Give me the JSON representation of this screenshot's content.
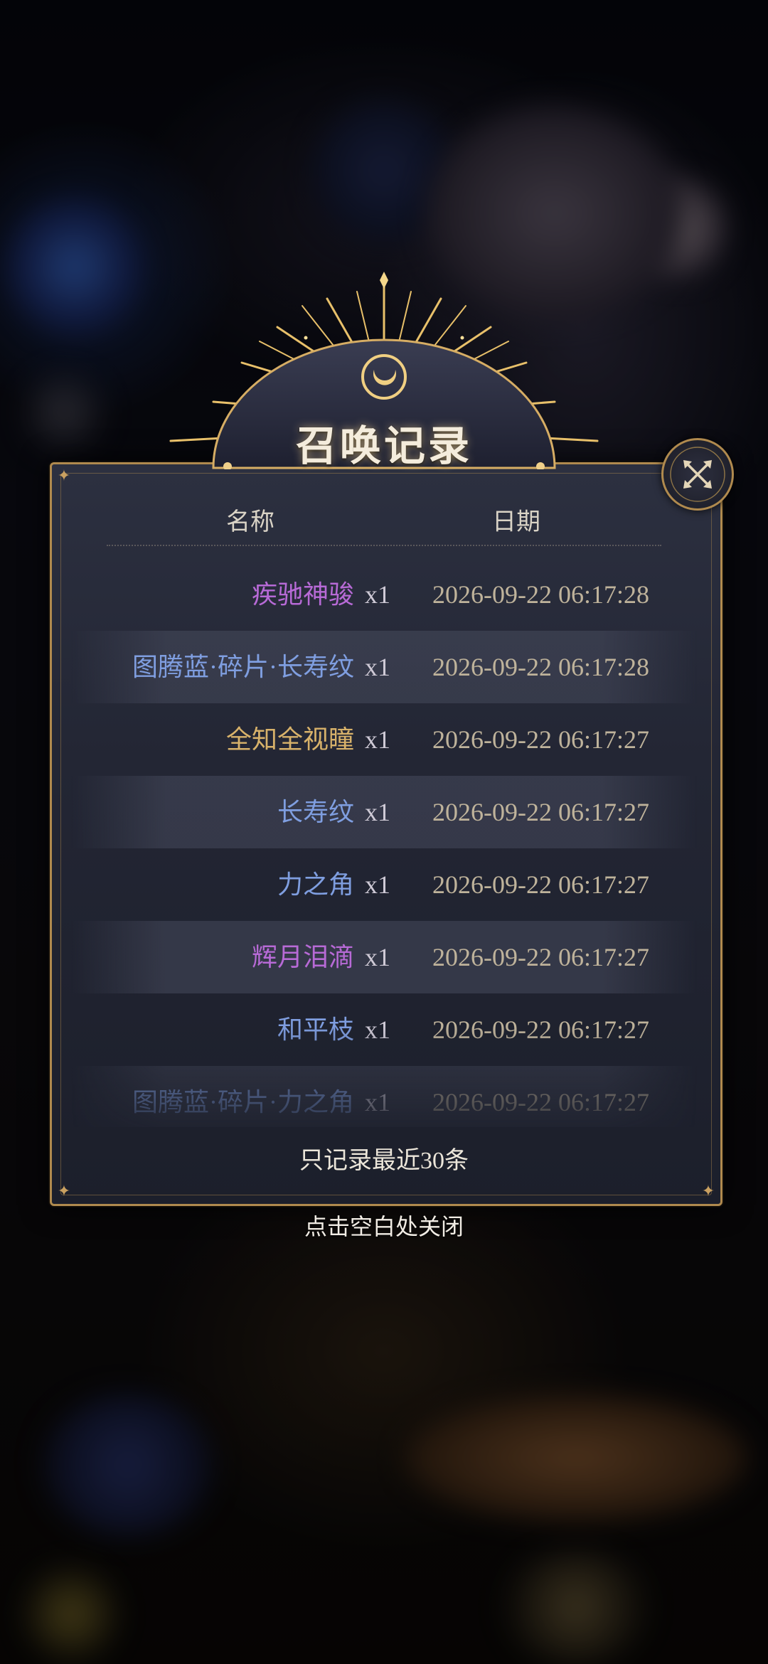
{
  "dialog": {
    "title": "召唤记录",
    "columns": {
      "name": "名称",
      "date": "日期"
    },
    "records": [
      {
        "name": "疾驰神骏",
        "qty": "x1",
        "date": "2026-09-22 06:17:28",
        "color": "#b76ad6"
      },
      {
        "name": "图腾蓝·碎片·长寿纹",
        "qty": "x1",
        "date": "2026-09-22 06:17:28",
        "color": "#7f9ee0"
      },
      {
        "name": "全知全视瞳",
        "qty": "x1",
        "date": "2026-09-22 06:17:27",
        "color": "#d8b26a"
      },
      {
        "name": "长寿纹",
        "qty": "x1",
        "date": "2026-09-22 06:17:27",
        "color": "#7f9ee0"
      },
      {
        "name": "力之角",
        "qty": "x1",
        "date": "2026-09-22 06:17:27",
        "color": "#7f9ee0"
      },
      {
        "name": "辉月泪滴",
        "qty": "x1",
        "date": "2026-09-22 06:17:27",
        "color": "#b76ad6"
      },
      {
        "name": "和平枝",
        "qty": "x1",
        "date": "2026-09-22 06:17:27",
        "color": "#7f9ee0"
      },
      {
        "name": "图腾蓝·碎片·力之角",
        "qty": "x1",
        "date": "2026-09-22 06:17:27",
        "color": "#7f9ee0"
      }
    ],
    "limit_note": "只记录最近30条",
    "close_icon": "close-icon"
  },
  "close_hint": "点击空白处关闭",
  "colors": {
    "frame_gold": "#b08a4e",
    "panel_bg": "#232634",
    "date_text": "#bfb39b"
  }
}
